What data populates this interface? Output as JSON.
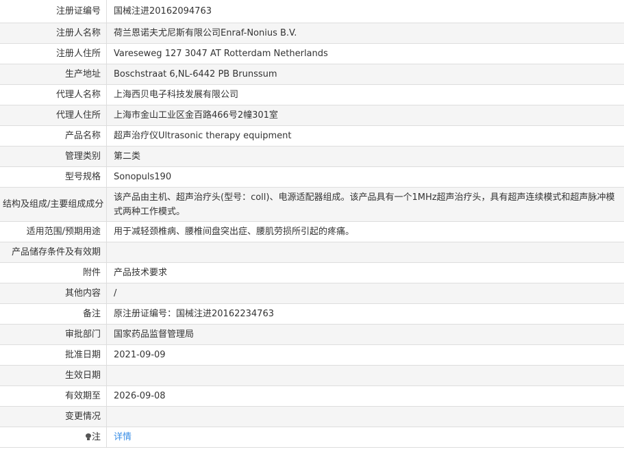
{
  "rows": [
    {
      "label": "注册证编号",
      "value": "国械注进20162094763"
    },
    {
      "label": "注册人名称",
      "value": "荷兰恩诺夫尤尼斯有限公司Enraf-Nonius B.V."
    },
    {
      "label": "注册人住所",
      "value": "Vareseweg 127 3047 AT Rotterdam Netherlands"
    },
    {
      "label": "生产地址",
      "value": "Boschstraat 6,NL-6442 PB Brunssum"
    },
    {
      "label": "代理人名称",
      "value": "上海西贝电子科技发展有限公司"
    },
    {
      "label": "代理人住所",
      "value": "上海市金山工业区金百路466号2幢301室"
    },
    {
      "label": "产品名称",
      "value": "超声治疗仪Ultrasonic therapy equipment"
    },
    {
      "label": "管理类别",
      "value": "第二类"
    },
    {
      "label": "型号规格",
      "value": "Sonopuls190"
    },
    {
      "label": "结构及组成/主要组成成分",
      "value": "该产品由主机、超声治疗头(型号：coll)、电源适配器组成。该产品具有一个1MHz超声治疗头，具有超声连续模式和超声脉冲模式两种工作模式。"
    },
    {
      "label": "适用范围/预期用途",
      "value": "用于减轻颈椎病、腰椎间盘突出症、腰肌劳损所引起的疼痛。"
    },
    {
      "label": "产品储存条件及有效期",
      "value": ""
    },
    {
      "label": "附件",
      "value": "产品技术要求"
    },
    {
      "label": "其他内容",
      "value": "/"
    },
    {
      "label": "备注",
      "value": "原注册证编号：国械注进20162234763"
    },
    {
      "label": "审批部门",
      "value": "国家药品监督管理局"
    },
    {
      "label": "批准日期",
      "value": "2021-09-09"
    },
    {
      "label": "生效日期",
      "value": ""
    },
    {
      "label": "有效期至",
      "value": "2026-09-08"
    },
    {
      "label": "变更情况",
      "value": ""
    }
  ],
  "note": {
    "label": "注",
    "icon": "bulb-icon",
    "link_text": "详情",
    "link_color": "#3a8ee6"
  }
}
